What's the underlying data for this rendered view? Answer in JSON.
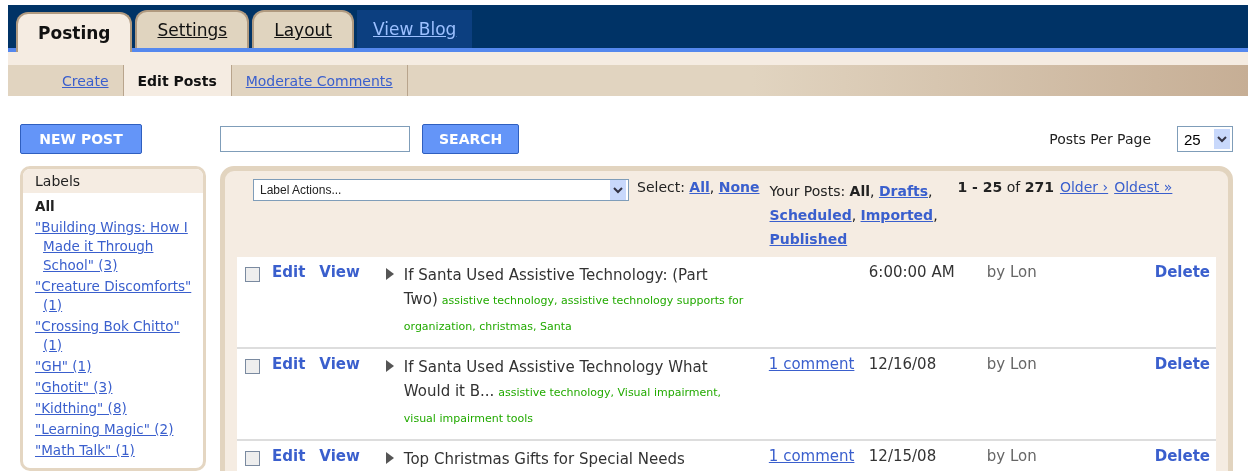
{
  "tabs": [
    {
      "label": "Posting",
      "selected": true
    },
    {
      "label": "Settings",
      "selected": false
    },
    {
      "label": "Layout",
      "selected": false
    }
  ],
  "view_blog": "View Blog",
  "subtabs": [
    {
      "label": "Create",
      "selected": false
    },
    {
      "label": "Edit Posts",
      "selected": true
    },
    {
      "label": "Moderate Comments",
      "selected": false
    }
  ],
  "new_post_button": "NEW POST",
  "search": {
    "button": "SEARCH"
  },
  "posts_per_page": {
    "label": "Posts Per Page",
    "value": "25"
  },
  "labels": {
    "title": "Labels",
    "items": [
      {
        "text": "All",
        "selected": true
      },
      {
        "text": "\"Building Wings: How I Made it Through School\" (3)",
        "selected": false
      },
      {
        "text": "\"Creature Discomforts\" (1)",
        "selected": false
      },
      {
        "text": "\"Crossing Bok Chitto\" (1)",
        "selected": false
      },
      {
        "text": "\"GH\" (1)",
        "selected": false
      },
      {
        "text": "\"Ghotit\" (3)",
        "selected": false
      },
      {
        "text": "\"Kidthing\" (8)",
        "selected": false
      },
      {
        "text": "\"Learning Magic\" (2)",
        "selected": false
      },
      {
        "text": "\"Math Talk\" (1)",
        "selected": false
      }
    ]
  },
  "label_actions": {
    "value": "Label Actions..."
  },
  "select": {
    "label": "Select:",
    "links": [
      {
        "text": "All",
        "sep": ","
      },
      {
        "text": "None"
      }
    ]
  },
  "your_posts": {
    "label": "Your Posts:",
    "filters": [
      {
        "text": "All",
        "sep": ",",
        "selected": true
      },
      {
        "text": "Drafts",
        "sep": ",",
        "selected": false
      },
      {
        "text": "Scheduled",
        "sep": ",",
        "selected": false
      },
      {
        "text": "Imported",
        "sep": ",",
        "selected": false
      },
      {
        "text": "Published",
        "selected": false
      }
    ]
  },
  "pagination": {
    "range": "**1 - 25** of **271**",
    "links": [
      "Older ›",
      "Oldest »"
    ]
  },
  "posts": [
    {
      "checked": false,
      "edit": "Edit",
      "view": "View",
      "title": "If Santa Used Assistive Technology: (Part Two)",
      "labels": "assistive technology, assistive technology supports for organization, christmas, Santa",
      "date": "6:00:00 AM",
      "author": "by Lon",
      "delete": "Delete"
    },
    {
      "checked": false,
      "edit": "Edit",
      "view": "View",
      "title": "If Santa Used Assistive Technology What Would it B...",
      "labels": "assistive technology, Visual impairment, visual impairment tools",
      "comments": "1 comment",
      "date": "12/16/08",
      "author": "by Lon",
      "delete": "Delete"
    },
    {
      "checked": false,
      "edit": "Edit",
      "view": "View",
      "title": "Top Christmas Gifts for Special Needs",
      "comments": "1 comment",
      "date": "12/15/08",
      "author": "by Lon",
      "delete": "Delete"
    }
  ]
}
